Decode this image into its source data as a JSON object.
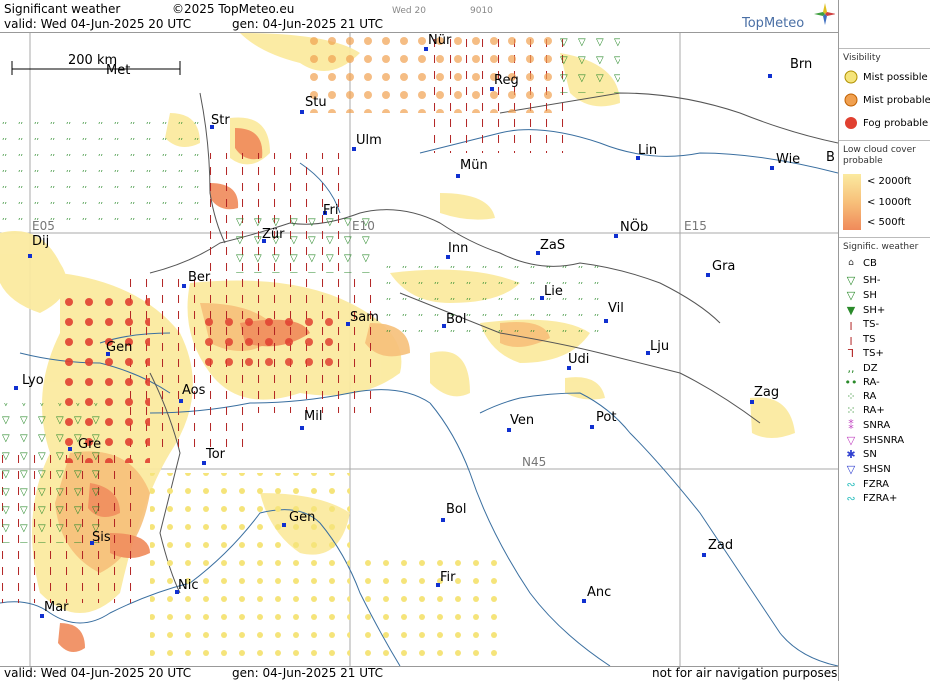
{
  "header": {
    "title": "Significant weather",
    "copyright": "©2025 TopMeteo.eu",
    "valid_line": "valid:  Wed  04-Jun-2025  20 UTC",
    "gen_line": "gen: 04-Jun-2025  21 UTC",
    "faint_left": "Wed 20",
    "faint_right": "9010",
    "brand": "TopMeteo"
  },
  "footer": {
    "valid_line": "valid:  Wed  04-Jun-2025   20 UTC",
    "gen_line": "gen: 04-Jun-2025  21 UTC",
    "disclaimer": "not for air navigation purposes"
  },
  "scale_label": "200 km",
  "grid_labels": [
    "E05",
    "E10",
    "E15",
    "N45"
  ],
  "cities": [
    "Nür",
    "Brn",
    "Reg",
    "Stu",
    "Str",
    "Ulm",
    "Lin",
    "Wie",
    "B",
    "Mün",
    "Fri",
    "NÖb",
    "E15",
    "Zür",
    "Inn",
    "ZaS",
    "Dij",
    "Gra",
    "Ber",
    "Lie",
    "Sam",
    "Vil",
    "Bol",
    "Gen",
    "Lju",
    "Udi",
    "Lyo",
    "Aos",
    "Zag",
    "Mil",
    "Ven",
    "Pot",
    "Gre",
    "Tor",
    "Gen",
    "Bol",
    "Sis",
    "Zad",
    "Nic",
    "Fir",
    "Anc",
    "Mar",
    "Met"
  ],
  "legend": {
    "visibility_title": "Visibility",
    "visibility": [
      "Mist possible",
      "Mist probable",
      "Fog probable"
    ],
    "cloud_title": "Low cloud cover probable",
    "cloud": [
      "< 2000ft",
      "< 1000ft",
      "<   500ft"
    ],
    "weather_title": "Signific. weather",
    "weather": [
      "CB",
      "SH-",
      "SH",
      "SH+",
      "TS-",
      "TS",
      "TS+",
      "DZ",
      "RA-",
      "RA",
      "RA+",
      "SNRA",
      "SHSNRA",
      "SN",
      "SHSN",
      "FZRA",
      "FZRA+"
    ]
  },
  "colors": {
    "mist_possible": "#f5e47a",
    "mist_probable": "#f0a050",
    "fog": "#e04030",
    "cloud_2000": "#fbeaa0",
    "cloud_1000": "#f7c07a",
    "cloud_500": "#f08a5a",
    "coast": "#3a6fa0",
    "border": "#444",
    "shower": "#2a8a2a",
    "thunder": "#b02020",
    "snow": "#3040d0",
    "snow_rain": "#c040c0",
    "fzra": "#30c0c0"
  }
}
